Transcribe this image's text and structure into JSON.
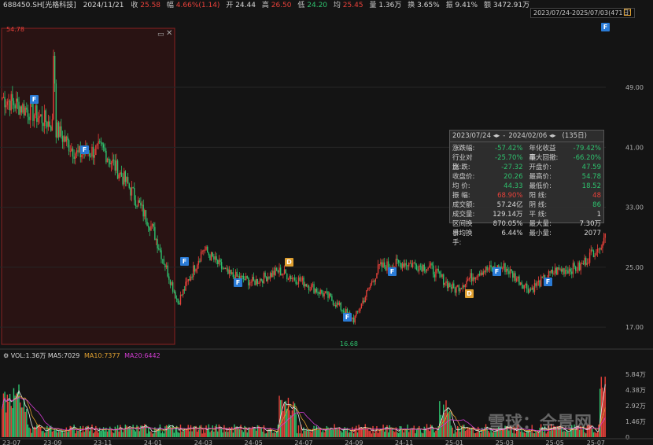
{
  "header": {
    "symbol": "688450.SH[光格科技]",
    "date": "2024/11/21",
    "close_label": "收",
    "close": "25.58",
    "change_label": "幅",
    "change": "4.66%(1.14)",
    "open_label": "开",
    "open": "24.44",
    "high_label": "高",
    "high": "26.50",
    "low_label": "低",
    "low": "24.20",
    "avg_label": "均",
    "avg": "25.45",
    "vol_label": "量",
    "vol": "1.36万",
    "turnover_label": "换",
    "turnover": "3.65%",
    "amp_label": "振",
    "amp": "9.41%",
    "amount_label": "额",
    "amount": "3472.91万"
  },
  "range_selector": {
    "label": "2023/07/24-2025/07/03(471日)"
  },
  "stats_panel": {
    "title_start": "2023/07/24 ◂▸",
    "title_sep": "-",
    "title_end": "2024/02/06 ◂▸",
    "title_days": "(135日)",
    "rows": [
      {
        "l1": "涨跌幅:",
        "v1": "-57.42%",
        "c1": "g",
        "l2": "年化收益率:",
        "v2": "-79.42%",
        "c2": "g"
      },
      {
        "l1": "行业对比:",
        "v1": "-25.70%",
        "c1": "g",
        "l2": "最大回撤:",
        "v2": "-66.20%",
        "c2": "g"
      },
      {
        "l1": "涨  跌:",
        "v1": "-27.32",
        "c1": "g",
        "l2": "开盘价:",
        "v2": "47.59",
        "c2": "g"
      },
      {
        "l1": "收盘价:",
        "v1": "20.26",
        "c1": "g",
        "l2": "最高价:",
        "v2": "54.78",
        "c2": "g"
      },
      {
        "l1": "均  价:",
        "v1": "44.33",
        "c1": "g",
        "l2": "最低价:",
        "v2": "18.52",
        "c2": "g"
      },
      {
        "l1": "振  幅:",
        "v1": "68.90%",
        "c1": "r",
        "l2": "阳  线:",
        "v2": "48",
        "c2": "r"
      },
      {
        "l1": "成交额:",
        "v1": "57.24亿",
        "c1": "w",
        "l2": "阴  线:",
        "v2": "86",
        "c2": "g"
      },
      {
        "l1": "成交量:",
        "v1": "129.14万",
        "c1": "w",
        "l2": "平  线:",
        "v2": "1",
        "c2": "w"
      },
      {
        "l1": "区间换手:",
        "v1": "870.05%",
        "c1": "w",
        "l2": "最大量:",
        "v2": "7.30万",
        "c2": "w"
      },
      {
        "l1": "日均换手:",
        "v1": "6.44%",
        "c1": "w",
        "l2": "最小量:",
        "v2": "2077",
        "c2": "w"
      }
    ]
  },
  "volume_legend": {
    "vol": "VOL:1.36万",
    "ma5": "MA5:7029",
    "ma10": "MA10:7377",
    "ma20": "MA20:6442"
  },
  "markers": {
    "max_label": "54.78",
    "min_label": "16.68"
  },
  "watermark": {
    "text": "雪球：全景网"
  },
  "colors": {
    "up": "#e8413a",
    "down": "#2ec26e",
    "bg": "#141414",
    "ma5": "#e8e8e8",
    "ma10": "#e0a030",
    "ma20": "#d03cd0",
    "flag": "#2a7bd6"
  },
  "chart_data": [
    {
      "type": "candlestick",
      "title": "",
      "xlabel": "",
      "ylabel": "",
      "x_ticks": [
        "23-07",
        "23-09",
        "23-11",
        "24-01",
        "24-03",
        "24-05",
        "24-07",
        "24-09",
        "24-11",
        "25-01",
        "25-03",
        "25-05",
        "25-07"
      ],
      "y_ticks": [
        49.0,
        41.0,
        33.0,
        25.0,
        17.0
      ],
      "ylim": [
        14.5,
        57.5
      ],
      "close_anchors": [
        {
          "x": "23-07",
          "y": 47.6
        },
        {
          "x": "23-08",
          "y": 46.0
        },
        {
          "x": "23-09",
          "y": 44.0
        },
        {
          "x": "23-10",
          "y": 40.0
        },
        {
          "x": "23-11",
          "y": 40.8
        },
        {
          "x": "23-12",
          "y": 36.0
        },
        {
          "x": "24-01",
          "y": 30.0
        },
        {
          "x": "24-02",
          "y": 20.3
        },
        {
          "x": "24-03",
          "y": 27.5
        },
        {
          "x": "24-04",
          "y": 24.0
        },
        {
          "x": "24-05",
          "y": 23.0
        },
        {
          "x": "24-06",
          "y": 24.5
        },
        {
          "x": "24-07",
          "y": 23.0
        },
        {
          "x": "24-08",
          "y": 21.0
        },
        {
          "x": "24-09",
          "y": 18.0
        },
        {
          "x": "24-10",
          "y": 25.0
        },
        {
          "x": "24-11",
          "y": 25.6
        },
        {
          "x": "24-12",
          "y": 25.0
        },
        {
          "x": "25-01",
          "y": 22.0
        },
        {
          "x": "25-02",
          "y": 24.5
        },
        {
          "x": "25-03",
          "y": 25.0
        },
        {
          "x": "25-04",
          "y": 22.0
        },
        {
          "x": "25-05",
          "y": 24.5
        },
        {
          "x": "25-06",
          "y": 25.0
        },
        {
          "x": "25-07",
          "y": 29.0
        }
      ],
      "period_high": 54.78,
      "period_low": 16.68,
      "flag_markers": [
        "F",
        "F",
        "F",
        "F",
        "D",
        "F",
        "F",
        "D",
        "F",
        "F",
        "F"
      ]
    },
    {
      "type": "bar",
      "title": "",
      "xlabel": "",
      "ylabel": "",
      "y_ticks": [
        "5.84万",
        "4.38万",
        "2.92万",
        "1.46万",
        "0"
      ],
      "ylim": [
        0,
        6.2
      ],
      "series": [
        {
          "name": "VOL",
          "values_desc": "daily volume bars (万)"
        },
        {
          "name": "MA5"
        },
        {
          "name": "MA10"
        },
        {
          "name": "MA20"
        }
      ]
    }
  ]
}
